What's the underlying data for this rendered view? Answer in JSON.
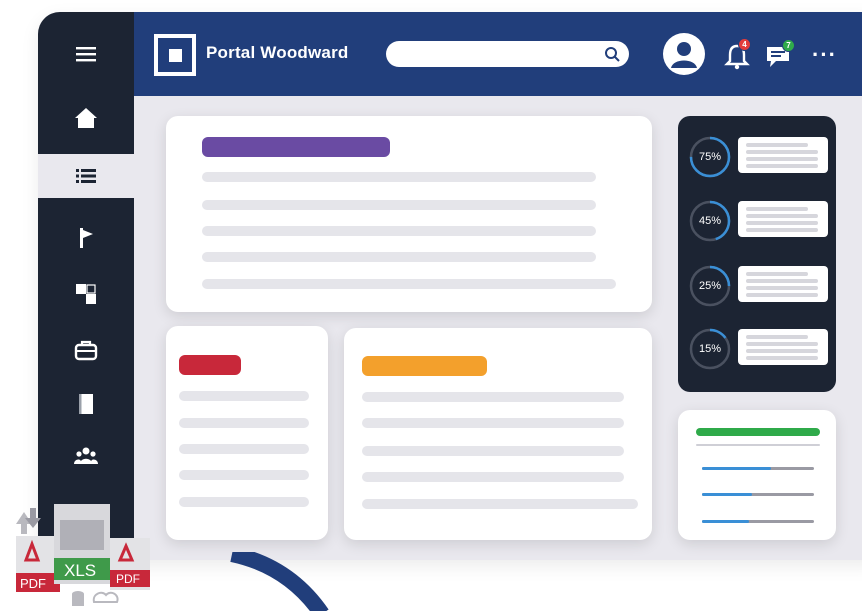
{
  "header": {
    "app_title": "Portal Woodward",
    "search_placeholder": "",
    "notifications_count": "4",
    "messages_count": "7"
  },
  "sidebar": {
    "items": [
      {
        "icon": "menu-icon"
      },
      {
        "icon": "home-icon"
      },
      {
        "icon": "list-icon",
        "active": true
      },
      {
        "icon": "flag-icon"
      },
      {
        "icon": "grid-icon"
      },
      {
        "icon": "briefcase-icon"
      },
      {
        "icon": "book-icon"
      },
      {
        "icon": "users-icon"
      }
    ]
  },
  "stats": [
    {
      "label": "75%",
      "value": 0.75
    },
    {
      "label": "45%",
      "value": 0.45
    },
    {
      "label": "25%",
      "value": 0.25
    },
    {
      "label": "15%",
      "value": 0.15
    }
  ],
  "progress_bars": [
    0.62,
    0.45,
    0.42
  ],
  "colors": {
    "topbar": "#213e7b",
    "sidebar": "#1c2433",
    "accent_purple": "#6a4ba3",
    "accent_red": "#c8283a",
    "accent_orange": "#f3a02c",
    "accent_green": "#2faa4a",
    "progress_blue": "#3a8fd6"
  },
  "files": {
    "pdf_label": "PDF",
    "xls_label": "XLS"
  }
}
